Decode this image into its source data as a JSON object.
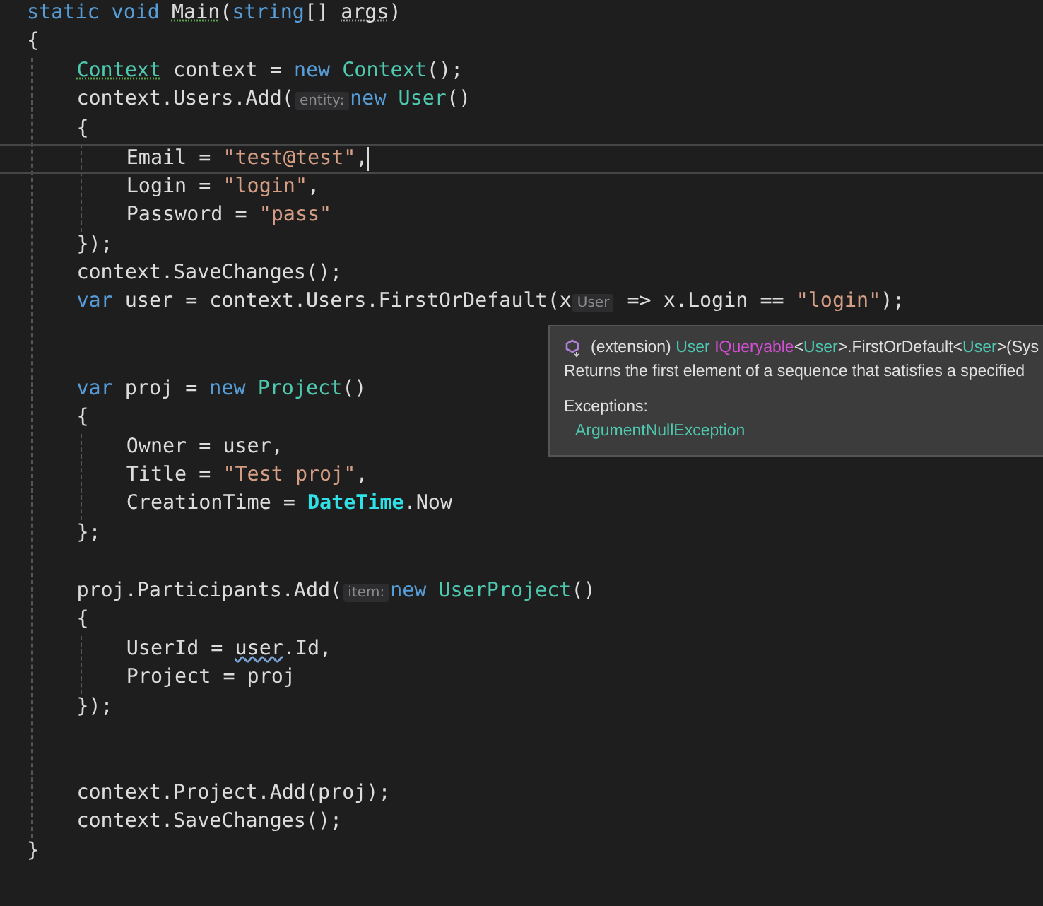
{
  "editor": {
    "lines": [
      {
        "current": false,
        "tokens": [
          {
            "text": "static void ",
            "kind": "keyword"
          },
          {
            "text": "Main",
            "kind": "suggested"
          },
          {
            "text": "(",
            "kind": "plain"
          },
          {
            "text": "string",
            "kind": "keyword"
          },
          {
            "text": "[] ",
            "kind": "plain"
          },
          {
            "text": "args",
            "kind": "unused"
          },
          {
            "text": ")",
            "kind": "plain"
          }
        ]
      },
      {
        "current": false,
        "tokens": [
          {
            "text": "{",
            "kind": "plain"
          }
        ],
        "children": [
          {
            "current": false,
            "tokens": [
              {
                "text": "Context",
                "kind": "suggestedtype"
              },
              {
                "text": " context = ",
                "kind": "plain"
              },
              {
                "text": "new ",
                "kind": "keyword"
              },
              {
                "text": "Context",
                "kind": "type"
              },
              {
                "text": "();",
                "kind": "plain"
              }
            ]
          },
          {
            "current": false,
            "tokens": [
              {
                "text": "context.Users.Add(",
                "kind": "plain"
              },
              {
                "text": "entity:",
                "kind": "hint"
              },
              {
                "text": "new ",
                "kind": "keyword"
              },
              {
                "text": "User",
                "kind": "type"
              },
              {
                "text": "()",
                "kind": "plain"
              }
            ]
          },
          {
            "current": false,
            "tokens": [
              {
                "text": "{",
                "kind": "plain"
              }
            ],
            "children": [
              {
                "current": true,
                "tokens": [
                  {
                    "text": "Email = ",
                    "kind": "plain"
                  },
                  {
                    "text": "\"test@test\"",
                    "kind": "string"
                  },
                  {
                    "text": ",",
                    "kind": "plain"
                  }
                ]
              },
              {
                "current": false,
                "tokens": [
                  {
                    "text": "Login = ",
                    "kind": "plain"
                  },
                  {
                    "text": "\"login\"",
                    "kind": "string"
                  },
                  {
                    "text": ",",
                    "kind": "plain"
                  }
                ]
              },
              {
                "current": false,
                "tokens": [
                  {
                    "text": "Password = ",
                    "kind": "plain"
                  },
                  {
                    "text": "\"pass\"",
                    "kind": "string"
                  }
                ]
              }
            ]
          },
          {
            "current": false,
            "tokens": [
              {
                "text": "});",
                "kind": "plain"
              }
            ]
          },
          {
            "current": false,
            "tokens": [
              {
                "text": "context.SaveChanges();",
                "kind": "plain"
              }
            ]
          },
          {
            "current": false,
            "tokens": [
              {
                "text": "var ",
                "kind": "keyword"
              },
              {
                "text": "user = context.Users.FirstOrDefault(x",
                "kind": "plain"
              },
              {
                "text": "User",
                "kind": "hint"
              },
              {
                "text": " => x.Login == ",
                "kind": "plain"
              },
              {
                "text": "\"login\"",
                "kind": "string"
              },
              {
                "text": ");",
                "kind": "plain"
              }
            ]
          },
          {
            "current": false
          },
          {
            "current": false
          },
          {
            "current": false,
            "tokens": [
              {
                "text": "var ",
                "kind": "keyword"
              },
              {
                "text": "proj = ",
                "kind": "plain"
              },
              {
                "text": "new ",
                "kind": "keyword"
              },
              {
                "text": "Project",
                "kind": "type"
              },
              {
                "text": "()",
                "kind": "plain"
              }
            ]
          },
          {
            "current": false,
            "tokens": [
              {
                "text": "{",
                "kind": "plain"
              }
            ],
            "children": [
              {
                "current": false,
                "tokens": [
                  {
                    "text": "Owner = user,",
                    "kind": "plain"
                  }
                ]
              },
              {
                "current": false,
                "tokens": [
                  {
                    "text": "Title = ",
                    "kind": "plain"
                  },
                  {
                    "text": "\"Test proj\"",
                    "kind": "string"
                  },
                  {
                    "text": ",",
                    "kind": "plain"
                  }
                ]
              },
              {
                "current": false,
                "tokens": [
                  {
                    "text": "CreationTime = ",
                    "kind": "plain"
                  },
                  {
                    "text": "DateTime",
                    "kind": "static"
                  },
                  {
                    "text": ".Now",
                    "kind": "plain"
                  }
                ]
              }
            ]
          },
          {
            "current": false,
            "tokens": [
              {
                "text": "};",
                "kind": "plain"
              }
            ]
          },
          {
            "current": false
          },
          {
            "current": false,
            "tokens": [
              {
                "text": "proj.Participants.Add(",
                "kind": "plain"
              },
              {
                "text": "item:",
                "kind": "hint"
              },
              {
                "text": "new ",
                "kind": "keyword"
              },
              {
                "text": "UserProject",
                "kind": "type"
              },
              {
                "text": "()",
                "kind": "plain"
              }
            ]
          },
          {
            "current": false,
            "tokens": [
              {
                "text": "{",
                "kind": "plain"
              }
            ],
            "children": [
              {
                "current": false,
                "tokens": [
                  {
                    "text": "UserId = ",
                    "kind": "plain"
                  },
                  {
                    "text": "user",
                    "kind": "warning"
                  },
                  {
                    "text": ".Id,",
                    "kind": "plain"
                  }
                ]
              },
              {
                "current": false,
                "tokens": [
                  {
                    "text": "Project = proj",
                    "kind": "plain"
                  }
                ]
              }
            ]
          },
          {
            "current": false,
            "tokens": [
              {
                "text": "});",
                "kind": "plain"
              }
            ]
          },
          {
            "current": false
          },
          {
            "current": false
          },
          {
            "current": false,
            "tokens": [
              {
                "text": "context.Project.Add(proj);",
                "kind": "plain"
              }
            ]
          },
          {
            "current": false,
            "tokens": [
              {
                "text": "context.SaveChanges();",
                "kind": "plain"
              }
            ]
          }
        ]
      },
      {
        "current": false,
        "tokens": [
          {
            "text": "}",
            "kind": "plain"
          }
        ]
      }
    ]
  },
  "tooltip": {
    "signature": [
      {
        "text": "(extension) ",
        "kind": "plain"
      },
      {
        "text": "User",
        "kind": "type"
      },
      {
        "text": " IQueryable",
        "kind": "interface"
      },
      {
        "text": "<",
        "kind": "plain"
      },
      {
        "text": "User",
        "kind": "type"
      },
      {
        "text": ">.FirstOrDefault<",
        "kind": "plain"
      },
      {
        "text": "User",
        "kind": "type"
      },
      {
        "text": ">(Sys",
        "kind": "plain"
      }
    ],
    "summary": "Returns the first element of a sequence that satisfies a specified",
    "exceptions_label": "Exceptions:",
    "exceptions": [
      "ArgumentNullException"
    ]
  }
}
